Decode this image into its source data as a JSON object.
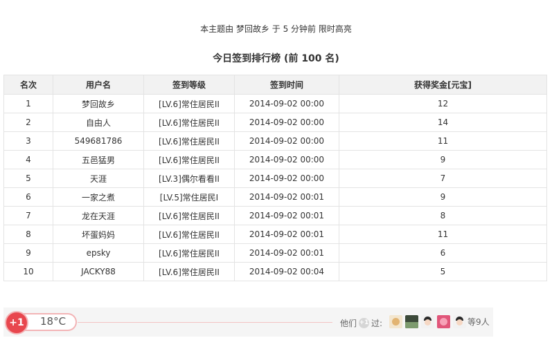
{
  "notice": "本主题由 梦回故乡 于 5 分钟前 限时高亮",
  "title": "今日签到排行榜 (前 100 名)",
  "table": {
    "headers": [
      "名次",
      "用户名",
      "签到等级",
      "签到时间",
      "获得奖金[元宝]"
    ],
    "rows": [
      {
        "rank": "1",
        "user": "梦回故乡",
        "level": "[LV.6]常住居民II",
        "time": "2014-09-02 00:00",
        "reward": "12"
      },
      {
        "rank": "2",
        "user": "自由人",
        "level": "[LV.6]常住居民II",
        "time": "2014-09-02 00:00",
        "reward": "14"
      },
      {
        "rank": "3",
        "user": "549681786",
        "level": "[LV.6]常住居民II",
        "time": "2014-09-02 00:00",
        "reward": "11"
      },
      {
        "rank": "4",
        "user": "五邑猛男",
        "level": "[LV.6]常住居民II",
        "time": "2014-09-02 00:00",
        "reward": "9"
      },
      {
        "rank": "5",
        "user": "天涯",
        "level": "[LV.3]偶尔看看II",
        "time": "2014-09-02 00:00",
        "reward": "7"
      },
      {
        "rank": "6",
        "user": "一家之煮",
        "level": "[LV.5]常住居民I",
        "time": "2014-09-02 00:01",
        "reward": "9"
      },
      {
        "rank": "7",
        "user": "龙在天涯",
        "level": "[LV.6]常住居民II",
        "time": "2014-09-02 00:01",
        "reward": "8"
      },
      {
        "rank": "8",
        "user": "坏蛋妈妈",
        "level": "[LV.6]常住居民II",
        "time": "2014-09-02 00:01",
        "reward": "11"
      },
      {
        "rank": "9",
        "user": "epsky",
        "level": "[LV.6]常住居民II",
        "time": "2014-09-02 00:01",
        "reward": "6"
      },
      {
        "rank": "10",
        "user": "JACKY88",
        "level": "[LV.6]常住居民II",
        "time": "2014-09-02 00:04",
        "reward": "5"
      }
    ]
  },
  "plus_one": {
    "button_label": "+1",
    "temperature": "18°C",
    "them_prefix": "他们",
    "mini_plus": "+1",
    "them_suffix": "过:",
    "others": "等9人",
    "avatar_icons": [
      "avatar-bear-icon",
      "avatar-landscape-icon",
      "avatar-person-icon",
      "avatar-flower-icon",
      "avatar-person-icon"
    ]
  },
  "colors": {
    "accent_red": "#e8474e",
    "accent_pink": "#f3b4b6",
    "header_bg": "#f2f2f2"
  }
}
